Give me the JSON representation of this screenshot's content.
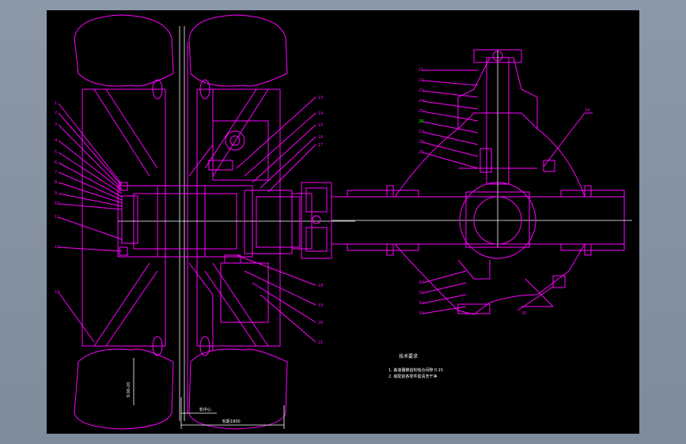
{
  "colors": {
    "line": "#ff00ff",
    "secondary": "#ffffff",
    "highlight": "#00ff00",
    "background": "#000000",
    "frame": "#8596a6"
  },
  "left_callouts": [
    "1",
    "2",
    "3",
    "4",
    "5",
    "6",
    "7",
    "8",
    "9",
    "10",
    "11",
    "12"
  ],
  "left_bottom_callout": "13",
  "mid_callouts_top": [
    "13",
    "14",
    "15",
    "16",
    "17"
  ],
  "mid_callouts_bottom": [
    "18",
    "19",
    "20",
    "21"
  ],
  "diff_callouts_top": [
    "21",
    "22",
    "23",
    "24",
    "25",
    "26",
    "27",
    "28",
    "29"
  ],
  "diff_callouts_bottom": [
    "30",
    "31",
    "32",
    "33"
  ],
  "diff_right_callout": "34",
  "diff_bottom_right_callout": "35",
  "dims": {
    "track_width": "轮距1800",
    "hub_label": "轮中心",
    "tire_label": "9.00-20"
  },
  "notes": {
    "title": "技术要求",
    "line1": "1. 差速器锥齿轮啮合间隙 0.15",
    "line2": "2. 装配前各零件需清洗干净"
  }
}
